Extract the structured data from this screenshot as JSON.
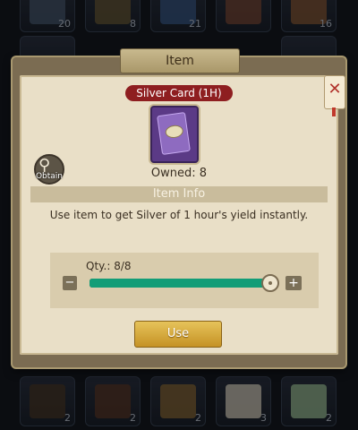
{
  "background": {
    "top_counts": [
      "20",
      "8",
      "21",
      "",
      "16"
    ],
    "bottom_counts": [
      "2",
      "2",
      "2",
      "3",
      "2"
    ]
  },
  "dialog": {
    "title": "Item",
    "close_icon": "close-icon",
    "item": {
      "name": "Silver Card (1H)",
      "icon": "silver-card-icon",
      "owned_text": "Owned: 8"
    },
    "obtain": {
      "icon": "magnifier-icon",
      "label": "Obtain"
    },
    "info_header": "Item Info",
    "description": "Use item to get Silver of 1 hour's yield instantly.",
    "quantity": {
      "label": "Qty.: 8/8",
      "value": 8,
      "max": 8,
      "minus_icon": "minus-icon",
      "plus_icon": "plus-icon"
    },
    "use_label": "Use"
  },
  "colors": {
    "slider_fill": "#129d77",
    "name_badge": "#8e1e20",
    "use_button": "#d4a53a"
  }
}
